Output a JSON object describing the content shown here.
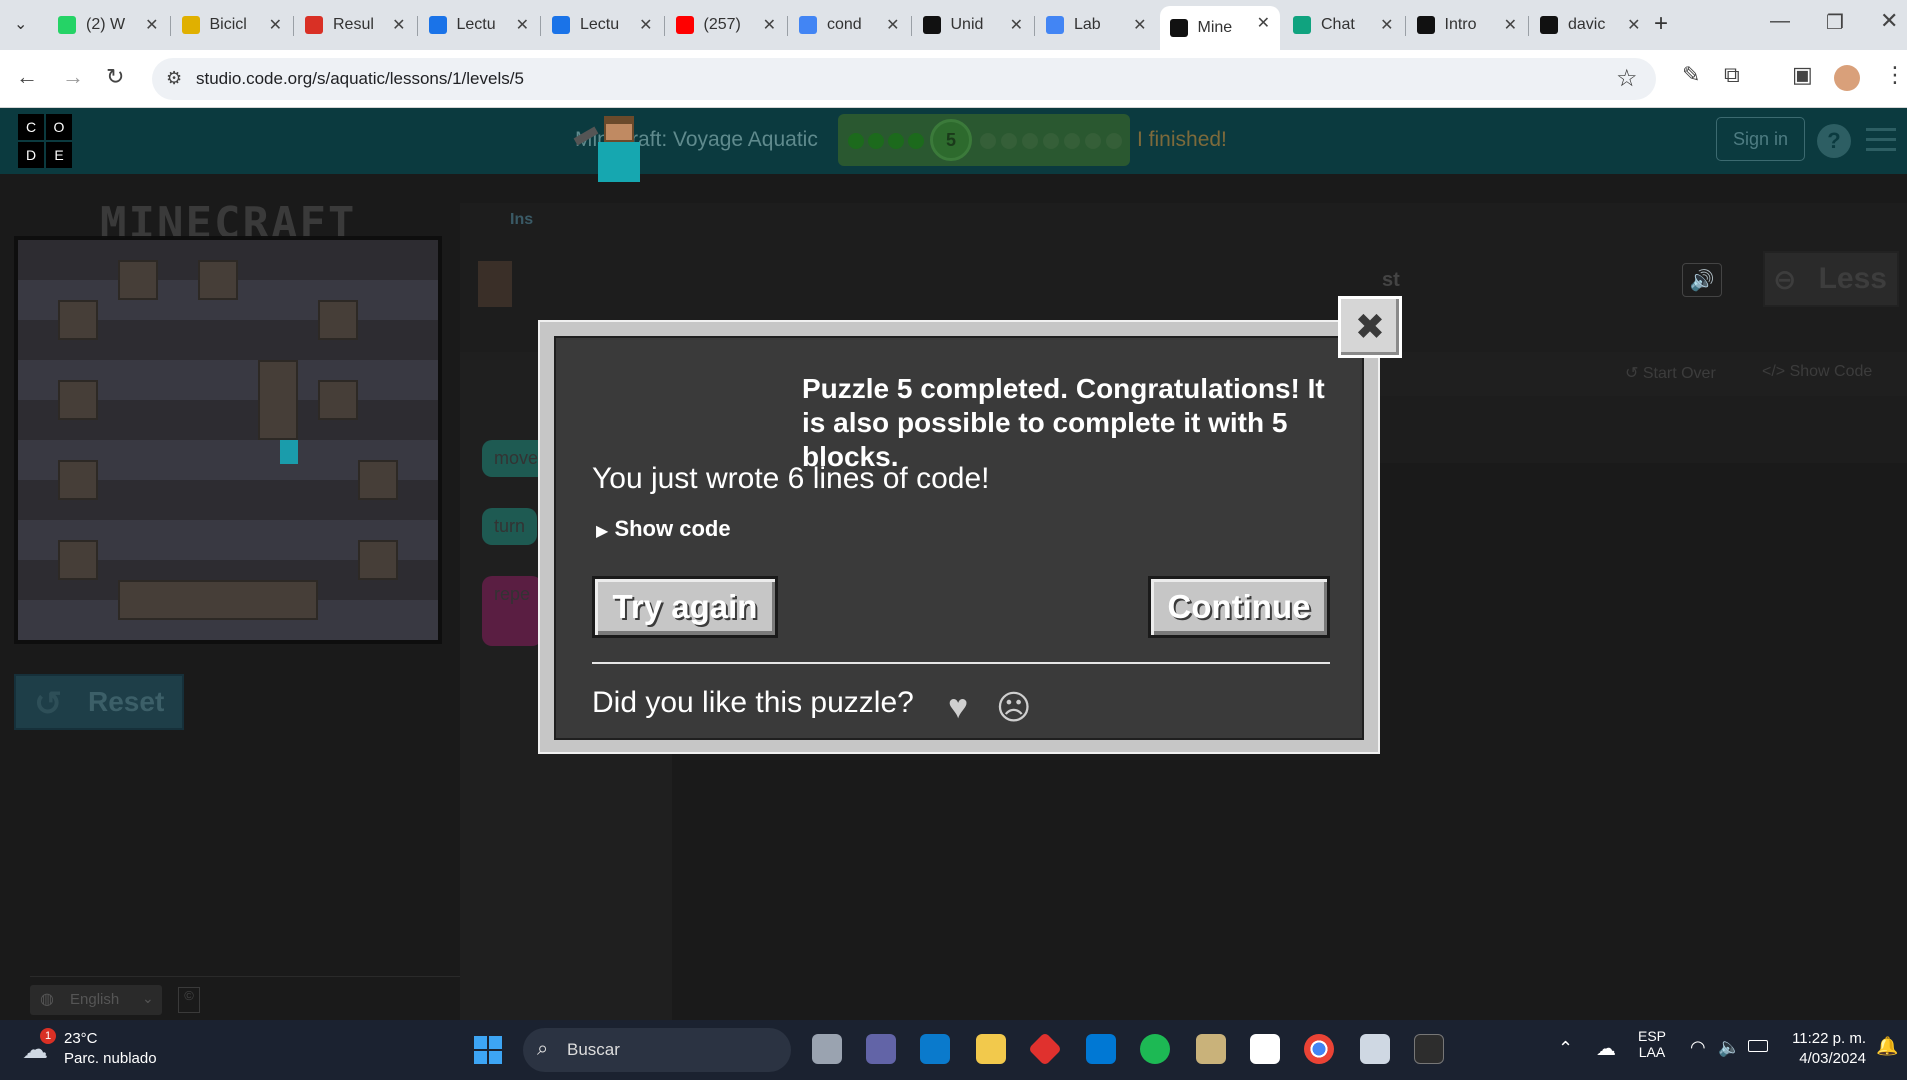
{
  "browser": {
    "tabs": [
      {
        "label": "(2) W",
        "icon": "whatsapp-icon",
        "color": "#25d366"
      },
      {
        "label": "Bicicl",
        "icon": "site-icon",
        "color": "#e0b000"
      },
      {
        "label": "Resul",
        "icon": "gmail-icon",
        "color": "#d93025"
      },
      {
        "label": "Lectu",
        "icon": "drive-icon",
        "color": "#1a73e8"
      },
      {
        "label": "Lectu",
        "icon": "drive-icon",
        "color": "#1a73e8"
      },
      {
        "label": "(257)",
        "icon": "youtube-icon",
        "color": "#ff0000"
      },
      {
        "label": "cond",
        "icon": "google-icon",
        "color": "#4285f4"
      },
      {
        "label": "Unid",
        "icon": "notion-icon",
        "color": "#111111"
      },
      {
        "label": "Lab",
        "icon": "docs-icon",
        "color": "#4285f4"
      },
      {
        "label": "Mine",
        "icon": "code-org-icon",
        "color": "#111111"
      },
      {
        "label": "Chat",
        "icon": "chatgpt-icon",
        "color": "#10a37f"
      },
      {
        "label": "Intro",
        "icon": "notion-icon",
        "color": "#111111"
      },
      {
        "label": "davic",
        "icon": "github-icon",
        "color": "#111111"
      }
    ],
    "url": "studio.code.org/s/aquatic/lessons/1/levels/5"
  },
  "header": {
    "logo_letters": [
      "C",
      "O",
      "D",
      "E"
    ],
    "lesson_title": "Minecraft: Voyage Aquatic",
    "progress_current": "5",
    "finished_label": "I finished!",
    "sign_in": "Sign in",
    "help": "?"
  },
  "game": {
    "logo": "MINECRAFT",
    "reset_label": "Reset",
    "language": "English"
  },
  "workspace": {
    "instructions_tab": "Ins",
    "less_label": "Less",
    "start_over": "Start Over",
    "show_code": "Show Code",
    "blocks": [
      "move",
      "turn",
      "repe"
    ],
    "goal_fragment": "st"
  },
  "dialog": {
    "message": "Puzzle 5 completed. Congratulations! It is also possible to complete it with 5 blocks.",
    "lines_written": "You just wrote 6 lines of code!",
    "show_code": "Show code",
    "try_again": "Try again",
    "continue": "Continue",
    "feedback_question": "Did you like this puzzle?"
  },
  "taskbar": {
    "weather_temp": "23°C",
    "weather_desc": "Parc. nublado",
    "weather_badge": "1",
    "search": "Buscar",
    "lang1": "ESP",
    "lang2": "LAA",
    "time": "11:22 p. m.",
    "date": "4/03/2024"
  }
}
